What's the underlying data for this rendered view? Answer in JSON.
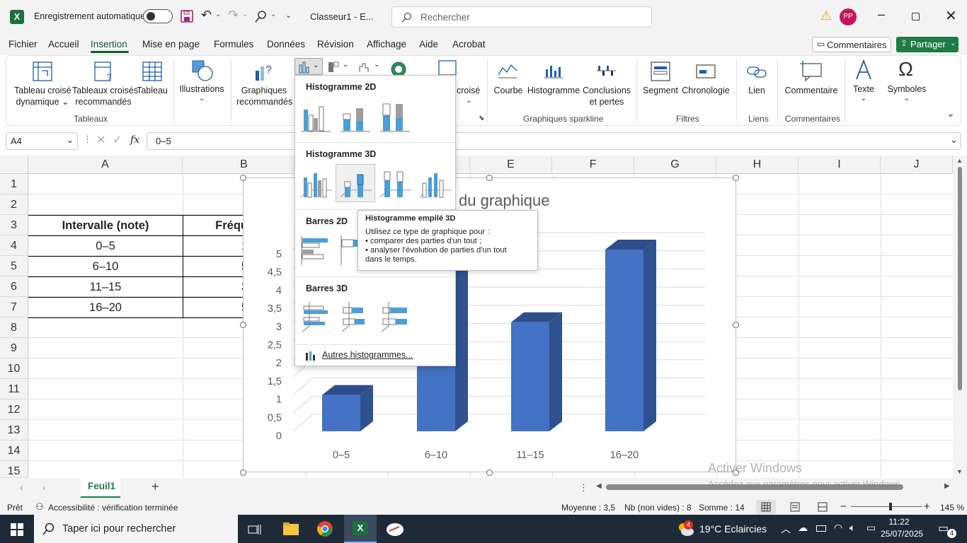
{
  "titlebar": {
    "autosave_label": "Enregistrement automatique",
    "filename": "Classeur1  -  E...",
    "search_placeholder": "Rechercher",
    "user_initials": "PP"
  },
  "menu": {
    "items": [
      "Fichier",
      "Accueil",
      "Insertion",
      "Mise en page",
      "Formules",
      "Données",
      "Révision",
      "Affichage",
      "Aide",
      "Acrobat"
    ],
    "active": "Insertion",
    "comments_label": "Commentaires",
    "share_label": "Partager"
  },
  "ribbon": {
    "pivot_table": [
      "Tableau croisé",
      "dynamique"
    ],
    "recommended_pivot": [
      "Tableaux croisés",
      "recommandés"
    ],
    "table": "Tableau",
    "tables_group": "Tableaux",
    "illustrations": "Illustrations",
    "recommended_charts": [
      "Graphiques",
      "recommandés"
    ],
    "pivot_chart_partial": [
      "croisé"
    ],
    "sparkline_line": "Courbe",
    "sparkline_column": "Histogramme",
    "sparkline_winloss": [
      "Conclusions",
      "et pertes"
    ],
    "sparklines_group": "Graphiques sparkline",
    "slicer": "Segment",
    "timeline": "Chronologie",
    "filters_group": "Filtres",
    "link": "Lien",
    "links_group": "Liens",
    "comment": "Commentaire",
    "comments_group": "Commentaires",
    "text": "Texte",
    "symbols": "Symboles"
  },
  "formulabar": {
    "namebox": "A4",
    "fx": "fx",
    "formula": "0–5"
  },
  "grid": {
    "columns": [
      "A",
      "B",
      "C",
      "D",
      "E",
      "F",
      "G",
      "H",
      "I",
      "J"
    ],
    "rows": [
      "1",
      "2",
      "3",
      "4",
      "5",
      "6",
      "7",
      "8",
      "9",
      "10",
      "11",
      "12",
      "13",
      "14",
      "15"
    ],
    "header_a": "Intervalle (note)",
    "header_b": "Fréqu",
    "data_a": [
      "0–5",
      "6–10",
      "11–15",
      "16–20"
    ],
    "data_b": [
      "1",
      "5",
      "3",
      "5"
    ]
  },
  "chart": {
    "title_partial": "du graphique",
    "y_ticks": [
      "0",
      "0,5",
      "1",
      "1,5",
      "2",
      "2,5",
      "3",
      "3,5",
      "4",
      "4,5",
      "5"
    ],
    "bar_color": "#4472c4"
  },
  "chart_data": {
    "type": "bar",
    "categories": [
      "0–5",
      "6–10",
      "11–15",
      "16–20"
    ],
    "values": [
      1,
      5,
      3,
      5
    ],
    "ylim": [
      0,
      5
    ],
    "grid": true
  },
  "dropdown": {
    "sec_2d": "Histogramme 2D",
    "sec_3d": "Histogramme 3D",
    "sec_bar2d": "Barres 2D",
    "sec_bar3d": "Barres 3D",
    "more": "Autres histogrammes..."
  },
  "tooltip": {
    "title": "Histogramme empilé 3D",
    "line1": "Utilisez ce type de graphique pour :",
    "line2": "• comparer des parties d'un tout ;",
    "line3": "• analyser l'évolution de parties d'un tout",
    "line4": "dans le temps."
  },
  "sheets": {
    "tab": "Feuil1"
  },
  "watermark": {
    "line1": "Activer Windows",
    "line2": "Accédez aux paramètres pour activer Windows."
  },
  "status": {
    "ready": "Prêt",
    "accessibility": "Accessibilité : vérification terminée",
    "average": "Moyenne : 3,5",
    "count": "Nb (non vides) : 8",
    "sum": "Somme : 14",
    "zoom": "145 %"
  },
  "taskbar": {
    "search_placeholder": "Taper ici pour rechercher",
    "weather": "19°C  Eclaircies",
    "time": "11:22",
    "date": "25/07/2025",
    "notif_count": "4",
    "weather_badge": "4"
  }
}
